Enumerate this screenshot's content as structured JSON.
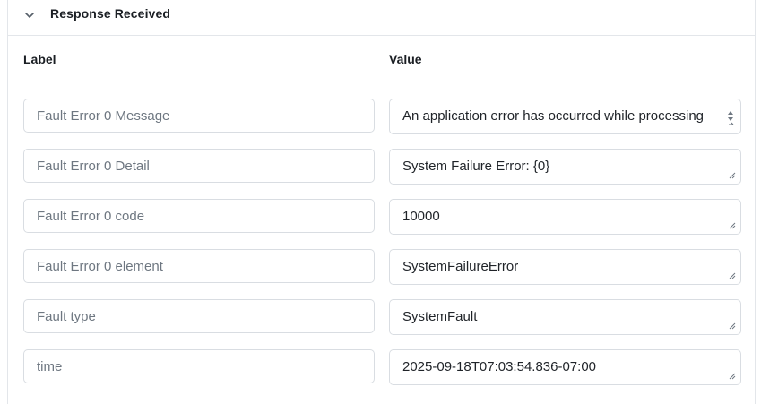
{
  "section": {
    "title": "Response Received",
    "collapse_icon": "chevron-down-icon"
  },
  "columns": {
    "label": "Label",
    "value": "Value"
  },
  "rows": [
    {
      "label": "Fault Error 0 Message",
      "value": "An application error has occurred while processing"
    },
    {
      "label": "Fault Error 0 Detail",
      "value": "System Failure Error: {0}"
    },
    {
      "label": "Fault Error 0 code",
      "value": "10000"
    },
    {
      "label": "Fault Error 0 element",
      "value": "SystemFailureError"
    },
    {
      "label": "Fault type",
      "value": "SystemFault"
    },
    {
      "label": "time",
      "value": "2025-09-18T07:03:54.836-07:00"
    }
  ],
  "colors": {
    "border": "#d9dde2",
    "label_text": "#6e7781",
    "value_text": "#1f2328"
  }
}
